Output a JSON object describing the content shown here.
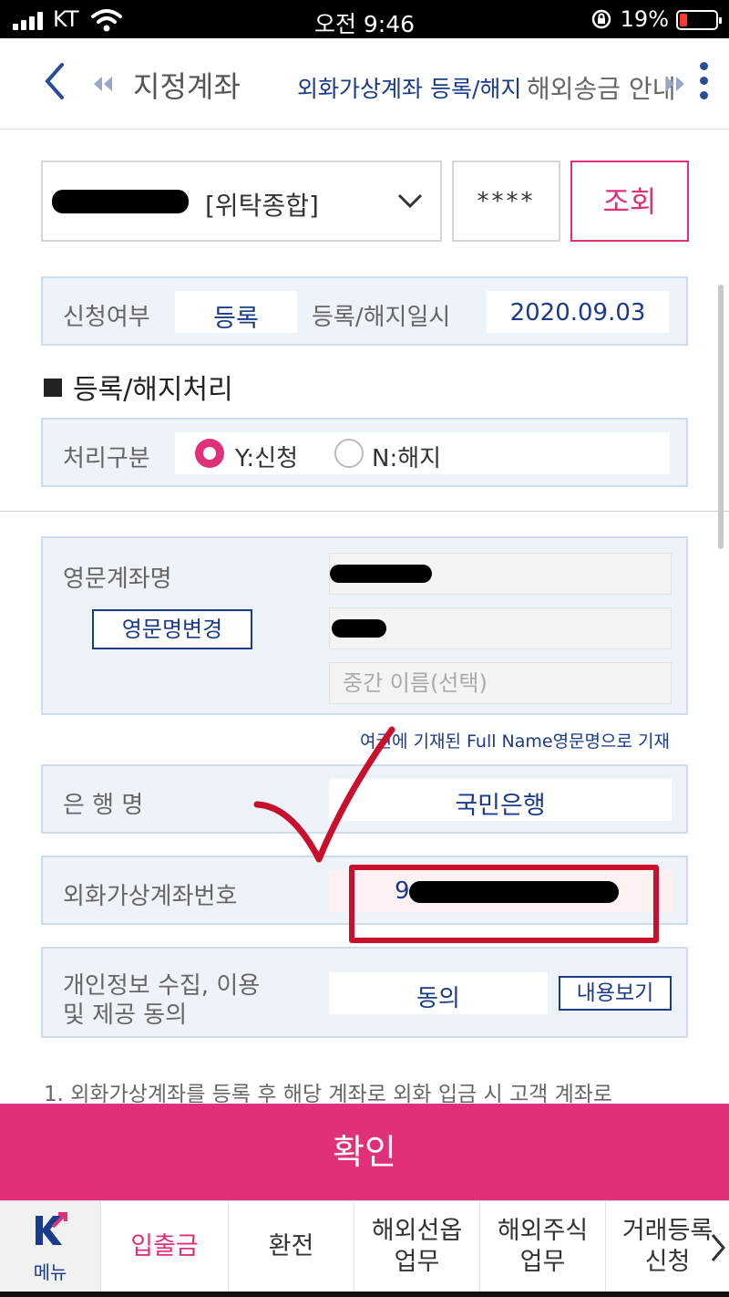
{
  "status_bar": {
    "carrier": "KT",
    "time": "오전 9:46",
    "battery": "19%"
  },
  "nav": {
    "prev_tab": "지정계좌",
    "active_tab": "외화가상계좌 등록/해지",
    "next_tab": "해외송금 안내"
  },
  "account": {
    "type": "[위탁종합]",
    "password_mask": "****",
    "query_label": "조회"
  },
  "registration": {
    "status_label": "신청여부",
    "status_value": "등록",
    "date_label": "등록/해지일시",
    "date_value": "2020.09.03"
  },
  "process": {
    "section_title": "등록/해지처리",
    "label": "처리구분",
    "option_yes": "Y:신청",
    "option_no": "N:해지",
    "selected": "Y"
  },
  "english_name": {
    "label": "영문계좌명",
    "change_button": "영문명변경",
    "middle_name_placeholder": "중간 이름(선택)",
    "note": "여권에 기재된 Full Name영문명으로 기재"
  },
  "bank": {
    "label": "은 행 명",
    "value": "국민은행"
  },
  "virtual_account": {
    "label": "외화가상계좌번호",
    "value_prefix": "9"
  },
  "privacy": {
    "label_line1": "개인정보 수집, 이용",
    "label_line2": "및 제공 동의",
    "value": "동의",
    "view_button": "내용보기"
  },
  "notice": "1. 외화가상계좌를 등록 후 해당 계좌로 외화 입금 시 고객 계좌로",
  "confirm_label": "확인",
  "bottom_nav": {
    "menu_label": "메뉴",
    "items": [
      {
        "line1": "입출금",
        "line2": ""
      },
      {
        "line1": "환전",
        "line2": ""
      },
      {
        "line1": "해외선옵",
        "line2": "업무"
      },
      {
        "line1": "해외주식",
        "line2": "업무"
      },
      {
        "line1": "거래등록",
        "line2": "신청"
      }
    ]
  },
  "colors": {
    "accent": "#e0307a",
    "primary": "#1a3a8a",
    "annotation": "#c8102e"
  }
}
